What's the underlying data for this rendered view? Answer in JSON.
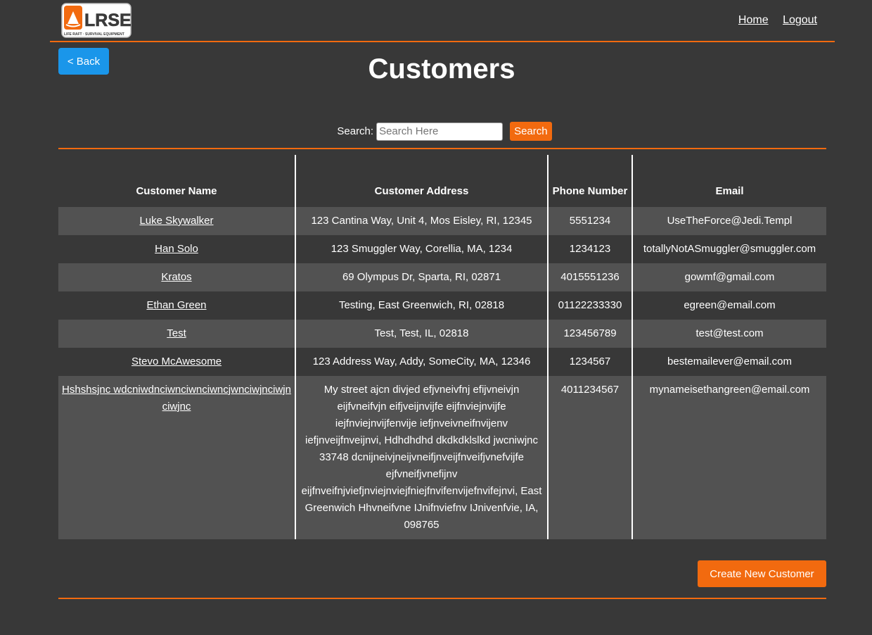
{
  "brand": {
    "logo_text": "LRSE",
    "logo_subtext": "LIFE RAFT · SURVIVAL EQUIPMENT"
  },
  "nav": {
    "home": "Home",
    "logout": "Logout"
  },
  "back_label": "< Back",
  "page_title": "Customers",
  "search": {
    "label": "Search:",
    "placeholder": "Search Here",
    "button": "Search"
  },
  "table": {
    "headers": [
      "Customer Name",
      "Customer Address",
      "Phone Number",
      "Email"
    ],
    "rows": [
      {
        "name": "Luke Skywalker",
        "address": "123 Cantina Way, Unit 4, Mos Eisley, RI, 12345",
        "phone": "5551234",
        "email": "UseTheForce@Jedi.Templ"
      },
      {
        "name": "Han Solo",
        "address": "123 Smuggler Way, Corellia, MA, 1234",
        "phone": "1234123",
        "email": "totallyNotASmuggler@smuggler.com"
      },
      {
        "name": "Kratos",
        "address": "69 Olympus Dr, Sparta, RI, 02871",
        "phone": "4015551236",
        "email": "gowmf@gmail.com"
      },
      {
        "name": "Ethan Green",
        "address": "Testing, East Greenwich, RI, 02818",
        "phone": "01122233330",
        "email": "egreen@email.com"
      },
      {
        "name": "Test",
        "address": "Test, Test, IL, 02818",
        "phone": "123456789",
        "email": "test@test.com"
      },
      {
        "name": "Stevo McAwesome",
        "address": "123 Address Way, Addy, SomeCity, MA, 12346",
        "phone": "1234567",
        "email": "bestemailever@email.com"
      },
      {
        "name": "Hshshsjnc wdcniwdnciwnciwnciwncjwnciwjnciwjnciwjnc",
        "address": "My street ajcn divjed efjvneivfnj efijvneivjn eijfvneifvjn eifjveijnvijfe eijfnviejnvijfe iejfnviejnvijfenvije iefjnveivneifnvijenv iefjnveijfnveijnvi, Hdhdhdhd dkdkdklslkd jwcniwjnc 33748 dcnijneivjneijvneifjnveijfnveifjvnefvijfe ejfvneifjvnefijnv eijfnveifnjviefjnviejnviejfniejfnvifenvijefnvifejnvi, East Greenwich Hhvneifvne IJnifnviefnv IJnivenfvie, IA, 098765",
        "phone": "4011234567",
        "email": "mynameisethangreen@email.com"
      }
    ]
  },
  "create_button": "Create New Customer",
  "colors": {
    "background": "#383838",
    "accent_orange": "#f26a0f",
    "back_button_blue": "#1a96ea",
    "row_alt": "#525252"
  }
}
